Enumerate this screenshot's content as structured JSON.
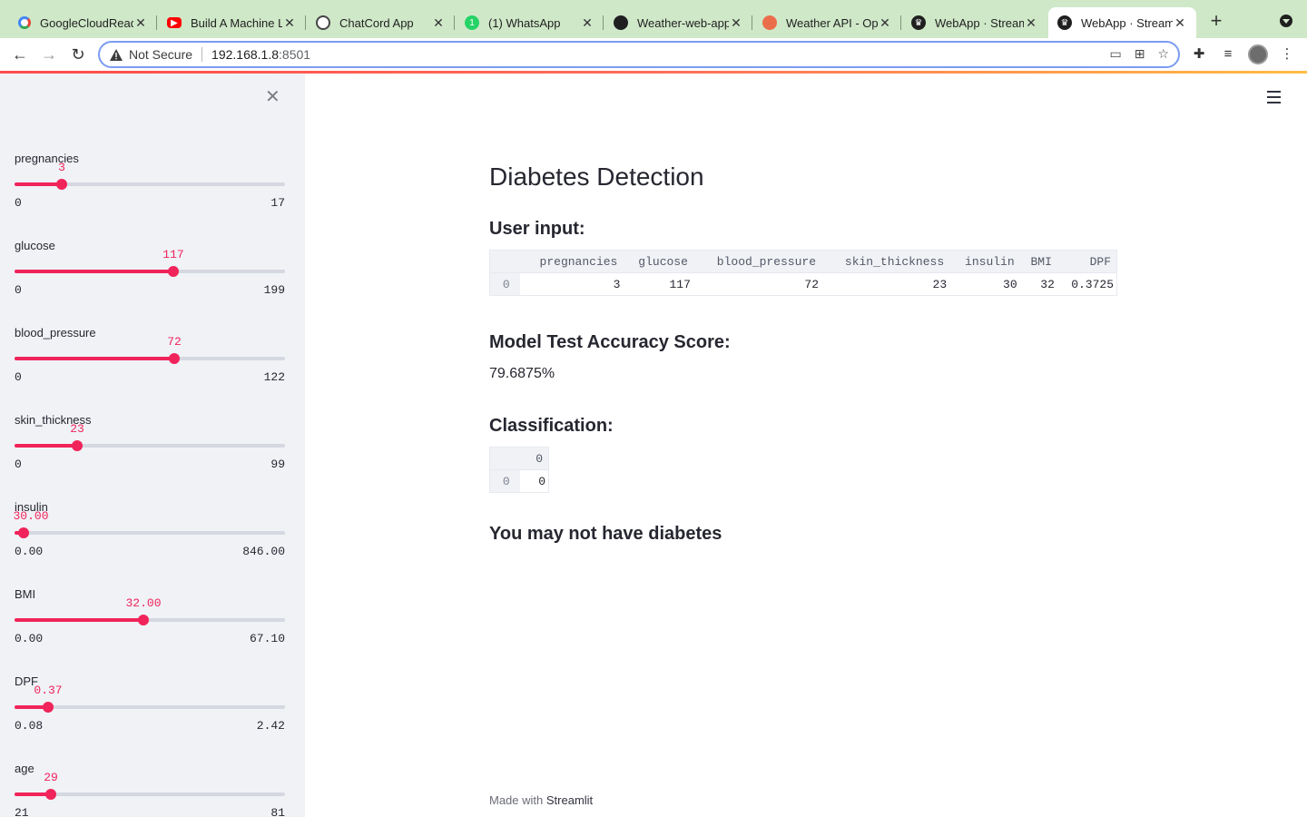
{
  "browser": {
    "tabs": [
      {
        "title": "GoogleCloudReady",
        "icon": "google-icon"
      },
      {
        "title": "Build A Machine Le",
        "icon": "youtube-icon"
      },
      {
        "title": "ChatCord App",
        "icon": "globe-icon"
      },
      {
        "title": "(1) WhatsApp",
        "icon": "whatsapp-icon"
      },
      {
        "title": "Weather-web-app",
        "icon": "github-icon"
      },
      {
        "title": "Weather API - Ope",
        "icon": "openweather-icon"
      },
      {
        "title": "WebApp · Streamlit",
        "icon": "streamlit-icon"
      },
      {
        "title": "WebApp · Streamlit",
        "icon": "streamlit-icon"
      }
    ],
    "security_label": "Not Secure",
    "url_host": "192.168.1.8",
    "url_port": ":8501"
  },
  "sidebar": {
    "sliders": [
      {
        "label": "pregnancies",
        "value": "3",
        "min": "0",
        "max": "17",
        "fraction": 0.176
      },
      {
        "label": "glucose",
        "value": "117",
        "min": "0",
        "max": "199",
        "fraction": 0.588
      },
      {
        "label": "blood_pressure",
        "value": "72",
        "min": "0",
        "max": "122",
        "fraction": 0.59
      },
      {
        "label": "skin_thickness",
        "value": "23",
        "min": "0",
        "max": "99",
        "fraction": 0.232
      },
      {
        "label": "insulin",
        "value": "30.00",
        "min": "0.00",
        "max": "846.00",
        "fraction": 0.035
      },
      {
        "label": "BMI",
        "value": "32.00",
        "min": "0.00",
        "max": "67.10",
        "fraction": 0.477
      },
      {
        "label": "DPF",
        "value": "0.37",
        "min": "0.08",
        "max": "2.42",
        "fraction": 0.124
      },
      {
        "label": "age",
        "value": "29",
        "min": "21",
        "max": "81",
        "fraction": 0.133
      }
    ]
  },
  "main": {
    "title": "Diabetes Detection",
    "user_input_heading": "User input:",
    "user_input_table": {
      "columns": [
        "pregnancies",
        "glucose",
        "blood_pressure",
        "skin_thickness",
        "insulin",
        "BMI",
        "DPF"
      ],
      "index": "0",
      "row": [
        "3",
        "117",
        "72",
        "23",
        "30",
        "32",
        "0.3725"
      ]
    },
    "accuracy_heading": "Model Test Accuracy Score:",
    "accuracy_value": "79.6875%",
    "classification_heading": "Classification:",
    "classification_table": {
      "column": "0",
      "index": "0",
      "value": "0"
    },
    "result_text": "You may not have diabetes"
  },
  "footer": {
    "prefix": "Made with",
    "brand": "Streamlit"
  }
}
